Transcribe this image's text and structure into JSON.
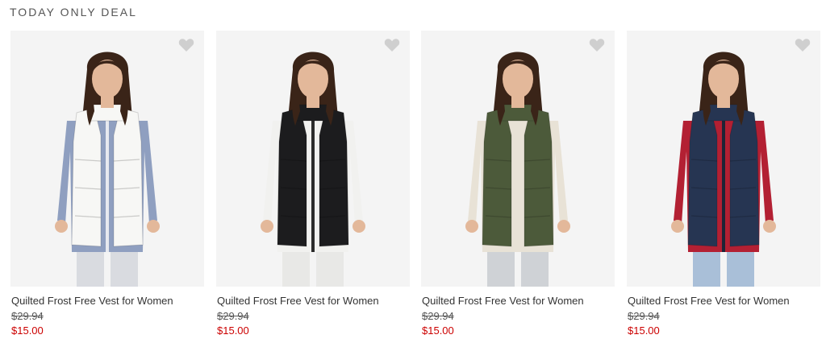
{
  "section": {
    "title": "TODAY ONLY DEAL"
  },
  "products": [
    {
      "name": "Quilted Frost Free Vest for Women",
      "original_price": "$29.94",
      "sale_price": "$15.00",
      "vest_color": "#f7f7f5",
      "shirt_color": "#8f9fc0",
      "shirt_alt": "#e7e9ef",
      "pants_color": "#d9dbe0"
    },
    {
      "name": "Quilted Frost Free Vest for Women",
      "original_price": "$29.94",
      "sale_price": "$15.00",
      "vest_color": "#1c1c1e",
      "shirt_color": "#f1f1ef",
      "shirt_alt": "#2b2b2b",
      "pants_color": "#e8e8e6"
    },
    {
      "name": "Quilted Frost Free Vest for Women",
      "original_price": "$29.94",
      "sale_price": "$15.00",
      "vest_color": "#4c5a3a",
      "shirt_color": "#e8e2d6",
      "shirt_alt": "#e8e2d6",
      "pants_color": "#cfd2d6"
    },
    {
      "name": "Quilted Frost Free Vest for Women",
      "original_price": "$29.94",
      "sale_price": "$15.00",
      "vest_color": "#263552",
      "shirt_color": "#b32033",
      "shirt_alt": "#1e2436",
      "pants_color": "#a9bfd8"
    }
  ],
  "colors": {
    "sale_price": "#cc0000",
    "heart": "#cfcfcf",
    "photo_bg": "#f4f4f4"
  },
  "icons": {
    "favorite": "heart-icon"
  }
}
